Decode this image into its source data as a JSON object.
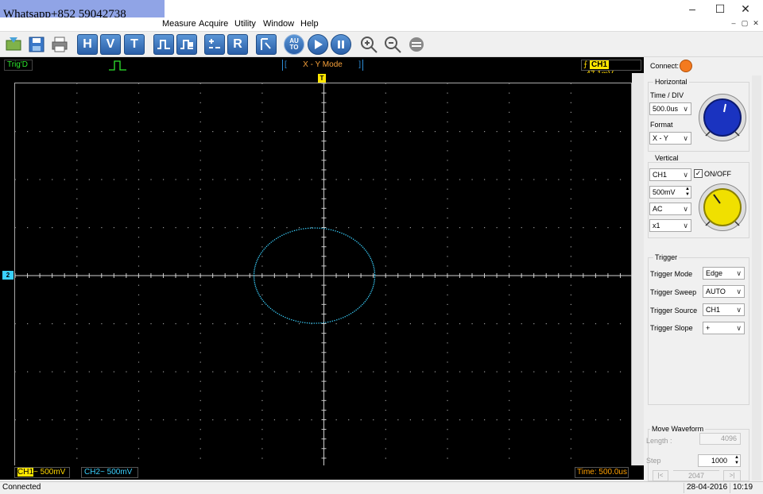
{
  "window": {
    "watermark": "Whatsapp+852 59042738",
    "controls": {
      "minimize": "–",
      "maximize": "☐",
      "close": "✕"
    },
    "mdi": {
      "minimize": "–",
      "restore": "▢",
      "close": "✕"
    }
  },
  "menu": [
    "Measure",
    "Acquire",
    "Utility",
    "Window",
    "Help"
  ],
  "toolbar": {
    "h": "H",
    "v": "V",
    "t": "T",
    "r": "R",
    "auto": "AU TO"
  },
  "scope": {
    "trigd": "Trig'D",
    "mode_left": "[",
    "mode": "X - Y Mode",
    "mode_right": "]",
    "trigger_marker": "T",
    "ch2_marker": "2",
    "trigger_channel": "CH1",
    "trigger_level": "-47.1mV",
    "ch1_tag": "CH1",
    "ch1_scale": "~ 500mV",
    "ch2_tag": "CH2",
    "ch2_scale": "~ 500mV",
    "time": "Time: 500.0us",
    "colors": {
      "ch1": "#ffe600",
      "ch2": "#3ad1ff",
      "grid": "#9a9a9a",
      "status": "#2ee62e",
      "mode": "#f6a03a"
    }
  },
  "panel": {
    "connect_label": "Connect:",
    "connect_color": "#f47a1f",
    "horizontal": {
      "title": "Horizontal",
      "time_div_label": "Time / DIV",
      "time_div": "500.0us",
      "format_label": "Format",
      "format": "X - Y",
      "knob_color": "#1a33c0"
    },
    "vertical": {
      "title": "Vertical",
      "channel": "CH1",
      "onoff_label": "ON/OFF",
      "onoff_checked": true,
      "volts": "500mV",
      "coupling": "AC",
      "probe": "x1",
      "knob_color": "#f0e000"
    },
    "trigger": {
      "title": "Trigger",
      "mode_label": "Trigger Mode",
      "mode": "Edge",
      "sweep_label": "Trigger Sweep",
      "sweep": "AUTO",
      "source_label": "Trigger Source",
      "source": "CH1",
      "slope_label": "Trigger Slope",
      "slope": "+"
    },
    "move": {
      "title": "Move Waveform",
      "length_label": "Length :",
      "length": "4096",
      "step_label": "Step",
      "step": "1000",
      "position": "2047",
      "prev": "|<",
      "next": ">|"
    }
  },
  "status": {
    "left": "Connected",
    "date": "28-04-2016",
    "time": "10:19"
  }
}
